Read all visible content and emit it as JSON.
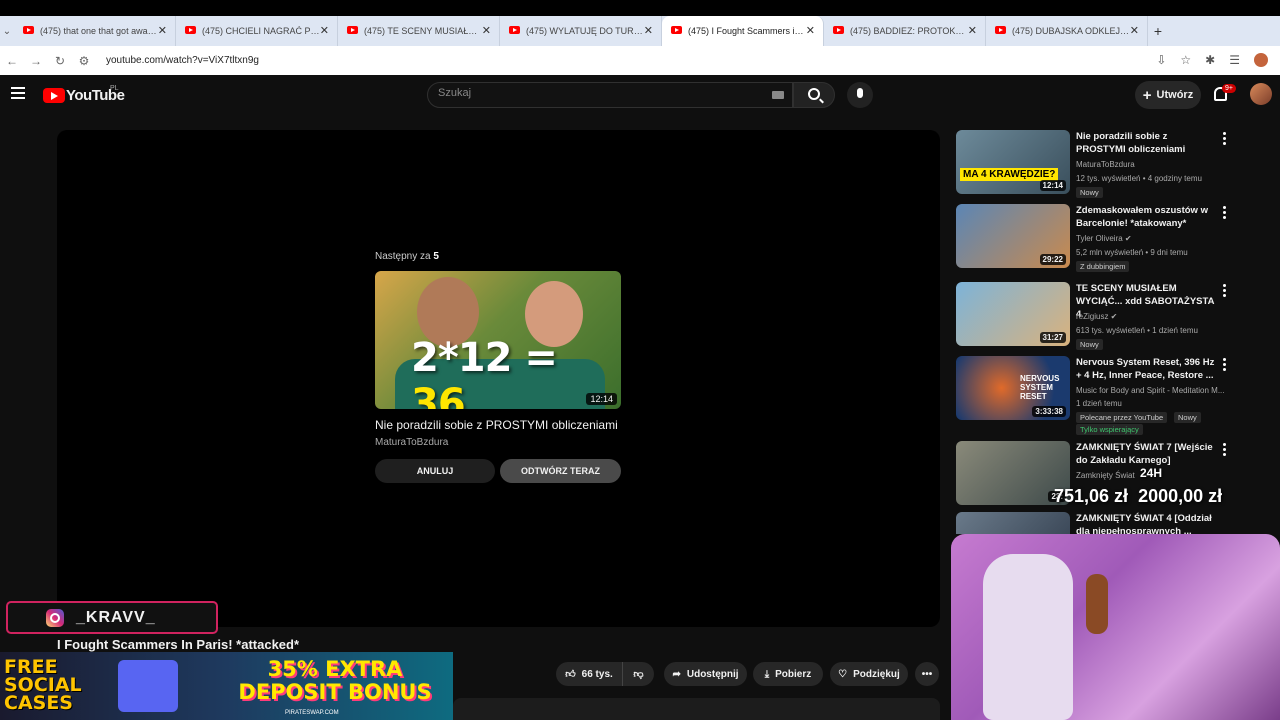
{
  "browser": {
    "tabs": [
      {
        "title": "(475) that one that got away re…",
        "active": false
      },
      {
        "title": "(475) CHCIELI NAGRAĆ POR… | …",
        "active": false
      },
      {
        "title": "(475) TE SCENY MUSIAŁEM WY…",
        "active": false
      },
      {
        "title": "(475) WYLATUJĘ DO TURCJI - Y…",
        "active": false
      },
      {
        "title": "(475) I Fought Scammers in …",
        "active": true
      },
      {
        "title": "(475) BADDIEZ: PROTOKÓŁ BEI…",
        "active": false
      },
      {
        "title": "(475) DUBAJSKA ODKLEJKA W…",
        "active": false
      }
    ],
    "url": "youtube.com/watch?v=ViX7tltxn9g",
    "new_tab_label": "+",
    "close_label": "✕"
  },
  "header": {
    "wordmark": "YouTube",
    "region": "PL",
    "search_placeholder": "Szukaj",
    "create_label": "Utwórz",
    "notif_count": "9+"
  },
  "player": {
    "up_next_prefix": "Następny za",
    "up_next_seconds": "5",
    "up_next_equation_left": "2*12 =",
    "up_next_equation_right": "36",
    "up_next_duration": "12:14",
    "up_next_title": "Nie poradzili sobie z PROSTYMI obliczeniami",
    "up_next_channel": "MaturaToBzdura",
    "cancel_label": "ANULUJ",
    "play_now_label": "ODTWÓRZ TERAZ"
  },
  "video": {
    "title": "I Fought Scammers In Paris! *attacked*",
    "likes": "66 tys.",
    "share_label": "Udostępnij",
    "download_label": "Pobierz",
    "thanks_label": "Podziękuj"
  },
  "recommendations": [
    {
      "title": "Nie poradzili sobie z PROSTYMI obliczeniami",
      "channel": "MaturaToBzdura",
      "meta": "12 tys. wyświetleń • 4 godziny temu",
      "badge": "Nowy",
      "duration": "12:14",
      "thumb_text": "MA 4 KRAWĘDZIE?"
    },
    {
      "title": "Zdemaskowałem oszustów w Barcelonie! *atakowany*",
      "channel": "Tyler Oliveira ✔",
      "meta": "5,2 mln wyświetleń • 9 dni temu",
      "badge": "Z dubbingiem",
      "duration": "29:22",
      "thumb_text": ""
    },
    {
      "title": "TE SCENY MUSIAŁEM WYCIĄĆ... xdd SABOTAŻYSTA 4",
      "channel": "reZigiusz ✔",
      "meta": "613 tys. wyświetleń • 1 dzień temu",
      "badge": "Nowy",
      "duration": "31:27",
      "thumb_text": ""
    },
    {
      "title": "Nervous System Reset, 396 Hz + 4 Hz, Inner Peace, Restore ...",
      "channel": "Music for Body and Spirit - Meditation M...",
      "meta": "1 dzień temu",
      "badge": "Polecane przez YouTube",
      "badge2": "Nowy",
      "badge3": "Tylko wspierający",
      "duration": "3:33:38",
      "thumb_text": "NERVOUS SYSTEM RESET"
    },
    {
      "title": "ZAMKNIĘTY ŚWIAT 7 [Wejście do Zakładu Karnego]",
      "channel": "Zamknięty Świat",
      "meta": "",
      "badge": "",
      "duration": "23:",
      "thumb_text": ""
    },
    {
      "title": "ZAMKNIĘTY ŚWIAT 4 [Oddział dla niepełnosprawnych ...",
      "channel": "",
      "meta": "",
      "badge": "",
      "duration": "",
      "thumb_text": ""
    }
  ],
  "overlay": {
    "instagram_handle": "_KRAVV_",
    "ad_left": "FREE SOCIAL CASES",
    "ad_right": "35% EXTRA DEPOSIT BONUS",
    "ad_url": "PIRATESWAP.COM",
    "goal_label": "24H",
    "goal_current": "751,06 zł",
    "goal_target": "2000,00 zł"
  },
  "colors": {
    "accent": "#ff0000",
    "background": "#0f0f0f",
    "instagram_border": "#d0235f"
  }
}
